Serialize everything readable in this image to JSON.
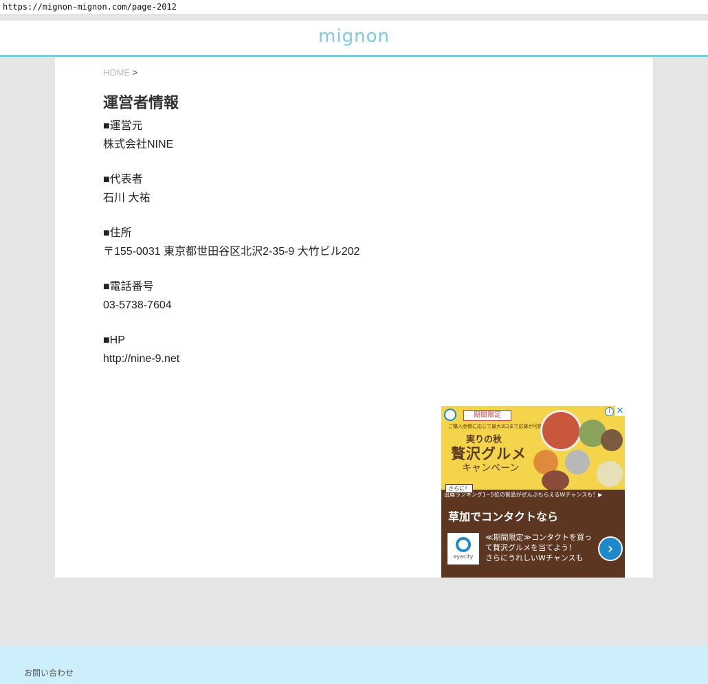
{
  "browser": {
    "url": "https://mignon-mignon.com/page-2012"
  },
  "header": {
    "logo": "mignon"
  },
  "breadcrumb": {
    "home": "HOME",
    "separator": ">"
  },
  "page": {
    "title": "運営者情報",
    "sections": [
      {
        "label": "■運営元",
        "value": "株式会社NINE"
      },
      {
        "label": "■代表者",
        "value": "石川 大祐"
      },
      {
        "label": "■住所",
        "value": "〒155-0031 東京都世田谷区北沢2-35-9 大竹ビル202"
      },
      {
        "label": "■電話番号",
        "value": "03-5738-7604"
      },
      {
        "label": "■HP",
        "value": "http://nine-9.net"
      }
    ]
  },
  "ad": {
    "badge": "期間限定",
    "small_text": "ご購入金額に応じて最大3口まで応募が可能！",
    "headline1": "実りの秋",
    "headline2": "贅沢グルメ",
    "headline3": "キャンペーン",
    "tag": "さらに！",
    "strip_text": "出展ランキング1~5位の賞品がぜんぶもらえるWチャンスも！▶",
    "title": "草加でコンタクトなら",
    "brand": "eyecity",
    "description_lines": [
      "≪期間限定≫コンタクトを買っ",
      "て贅沢グルメを当てよう！",
      "さらにうれしいWチャンスも"
    ],
    "arrow": "›",
    "info": "i",
    "close": "✕"
  },
  "footer": {
    "contact_link": "お問い合わせ"
  },
  "colors": {
    "accent": "#7ec8e3",
    "page_bg": "#e5e5e5",
    "footer_bg": "#cdeefb"
  }
}
